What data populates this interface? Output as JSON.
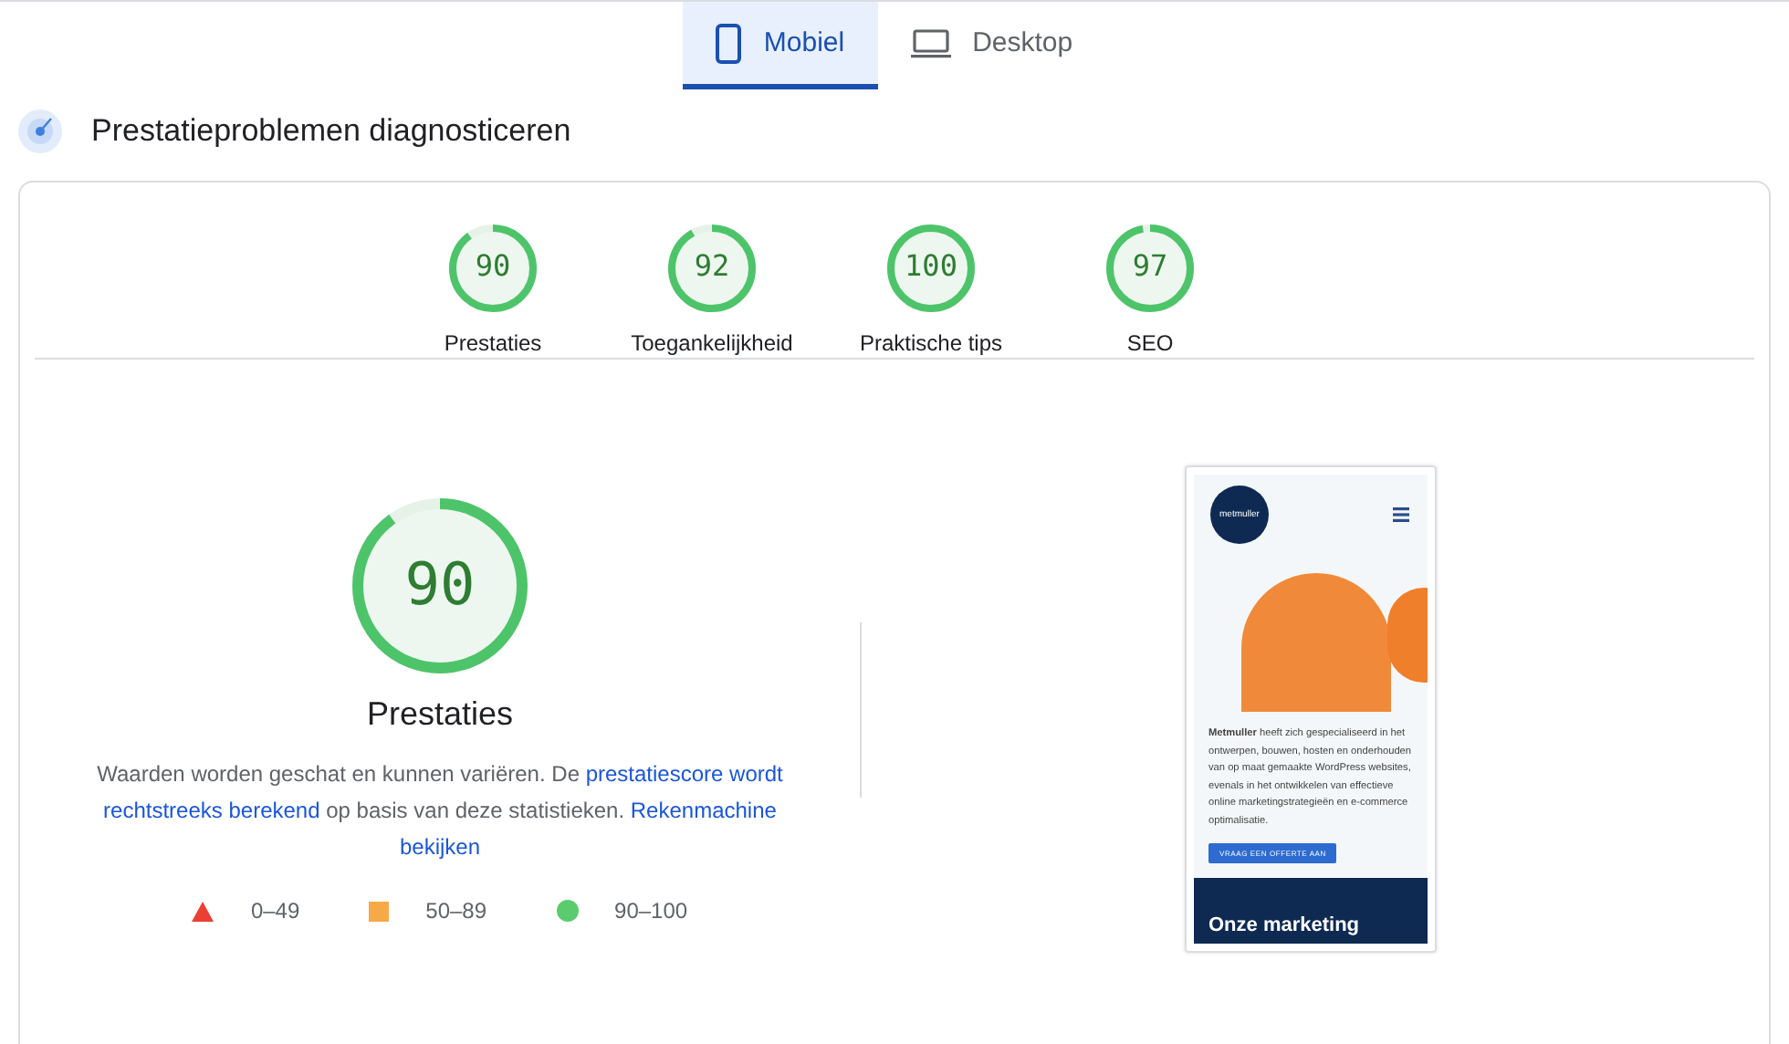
{
  "tabs": [
    {
      "label": "Mobiel",
      "kind": "phone",
      "selected": true
    },
    {
      "label": "Desktop",
      "kind": "laptop",
      "selected": false
    }
  ],
  "heading": "Prestatieproblemen diagnosticeren",
  "categories": [
    {
      "score": "90",
      "label": "Prestaties",
      "level": 0.9
    },
    {
      "score": "92",
      "label": "Toegankelijkheid",
      "level": 0.92
    },
    {
      "score": "100",
      "label": "Praktische tips",
      "level": 1
    },
    {
      "score": "97",
      "label": "SEO",
      "level": 0.97
    }
  ],
  "main_gauge": {
    "score": "90",
    "label": "Prestaties",
    "level": 0.9
  },
  "description": [
    {
      "kind": "text",
      "text": "Waarden worden geschat en kunnen variëren. De "
    },
    {
      "kind": "link",
      "text": "prestatiescore wordt"
    },
    {
      "kind": "space"
    },
    {
      "kind": "link",
      "text": "rechtstreeks berekend"
    },
    {
      "kind": "text",
      "text": " op basis van deze statistieken. "
    },
    {
      "kind": "link",
      "text": "Rekenmachine"
    },
    {
      "kind": "space"
    },
    {
      "kind": "link",
      "text": "bekijken"
    }
  ],
  "legend": [
    {
      "kind": "triangle",
      "range": "0–49"
    },
    {
      "kind": "square",
      "range": "50–89"
    },
    {
      "kind": "circle",
      "range": "90–100"
    }
  ],
  "screenshot": {
    "logo": "metmuller",
    "intro": "**Metmuller** heeft zich gespecialiseerd in het ontwerpen, bouwen, hosten en onderhouden van op maat gemaakte WordPress websites, evenals in het ontwikkelen van effectieve online marketingstrategieën en e-commerce optimalisatie.",
    "button": "VRAAG EEN OFFERTE AAN",
    "banner": "Onze marketing"
  }
}
